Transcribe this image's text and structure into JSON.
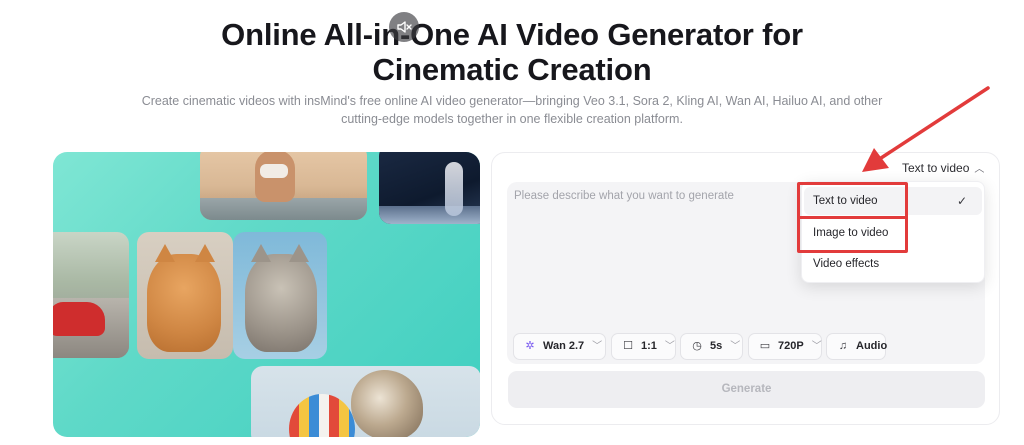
{
  "hero": {
    "title_line1": "Online All-in-One AI Video Generator for",
    "title_line2": "Cinematic Creation",
    "subtitle_line1": "Create cinematic videos with insMind's free online AI video generator—bringing Veo 3.1, Sora 2, Kling AI, Wan AI, Hailuo AI, and other",
    "subtitle_line2": "cutting-edge models together in one flexible creation platform."
  },
  "showcase": {
    "unmute_icon": "speaker-muted-icon"
  },
  "generator": {
    "mode_selected": "Text to video",
    "prompt_placeholder": "Please describe what you want to generate",
    "mode_menu": [
      "Text to video",
      "Image to video",
      "Video effects"
    ],
    "toolbar": {
      "model": "Wan 2.7",
      "ratio": "1:1",
      "duration": "5s",
      "resolution": "720P",
      "audio": "Audio"
    },
    "generate_label": "Generate"
  },
  "colors": {
    "annotation": "#e23b3b",
    "showcase_bg": "#5fd9c8"
  }
}
